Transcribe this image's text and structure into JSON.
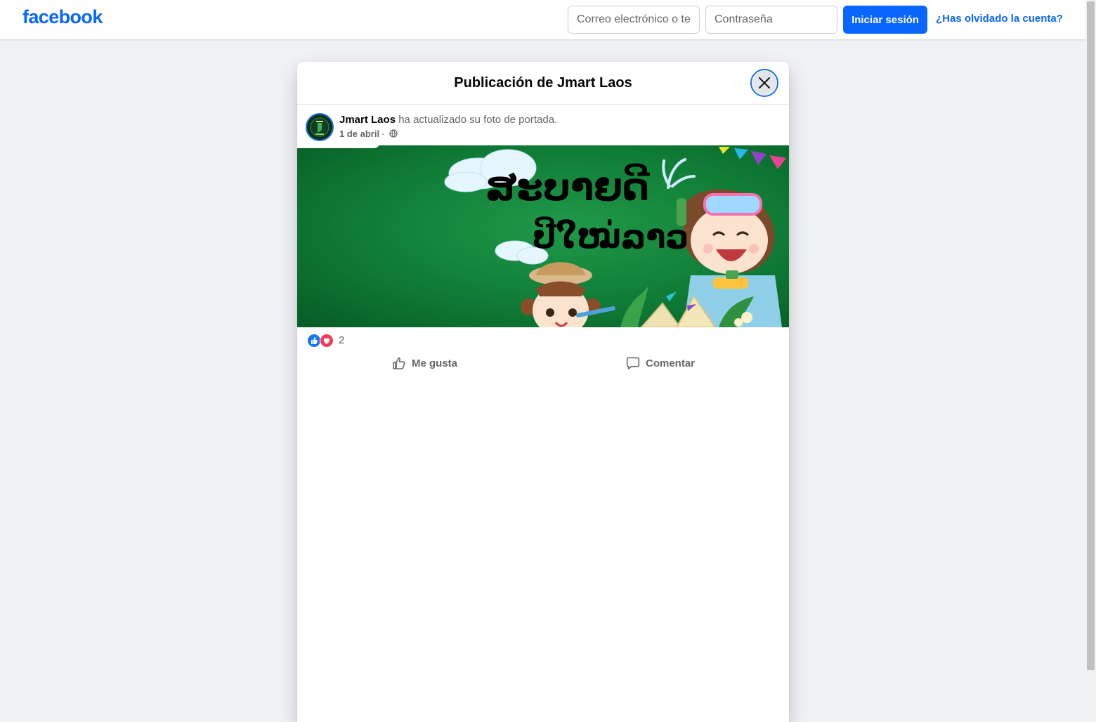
{
  "topbar": {
    "logo": "facebook",
    "email_placeholder": "Correo electrónico o teléfono",
    "password_placeholder": "Contraseña",
    "login_label": "Iniciar sesión",
    "forgot_label": "¿Has olvidado la cuenta?"
  },
  "dialog": {
    "title": "Publicación de Jmart Laos"
  },
  "post": {
    "author": "Jmart Laos",
    "action_text": "ha actualizado su foto de portada.",
    "date": "1 de abril",
    "separator": "·",
    "audience_icon": "globe-icon",
    "cover_text_line1": "ສະບາຍດີ",
    "cover_text_line2": "ປີໃໝ່ລາວ",
    "reaction_count": "2",
    "like_label": "Me gusta",
    "comment_label": "Comentar"
  },
  "colors": {
    "brand": "#0866ff",
    "cover_green": "#0f7a35",
    "like_blue": "#1877f2",
    "love_red": "#f33e58"
  }
}
